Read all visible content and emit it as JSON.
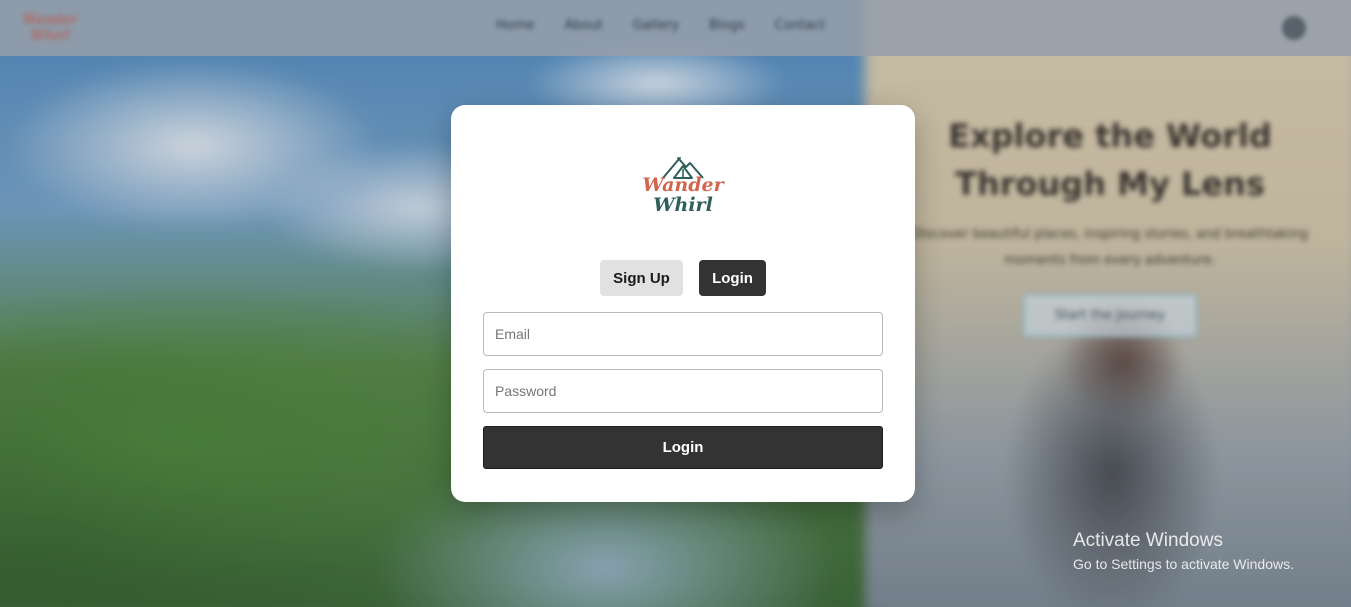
{
  "navbar": {
    "logo_text": "Wander Whirl",
    "links": [
      "Home",
      "About",
      "Gallery",
      "Blogs",
      "Contact"
    ]
  },
  "hero": {
    "title": "Explore the World Through My Lens",
    "subtitle": "Discover beautiful places, inspiring stories, and breathtaking moments from every adventure.",
    "button": "Start the Journey"
  },
  "modal": {
    "logo": {
      "line1": "Wander",
      "line2": "Whirl"
    },
    "tabs": {
      "signup": "Sign Up",
      "login": "Login"
    },
    "email": {
      "placeholder": "Email",
      "value": ""
    },
    "password": {
      "placeholder": "Password",
      "value": ""
    },
    "submit_label": "Login"
  },
  "watermark": {
    "title": "Activate Windows",
    "subtitle": "Go to Settings to activate Windows."
  },
  "colors": {
    "brand_coral": "#d3654e",
    "brand_teal": "#2e5f5a",
    "button_dark": "#333333",
    "tab_inactive": "#e1e1e1"
  },
  "icons": [
    "tent-mountain-logo-icon",
    "user-icon"
  ]
}
